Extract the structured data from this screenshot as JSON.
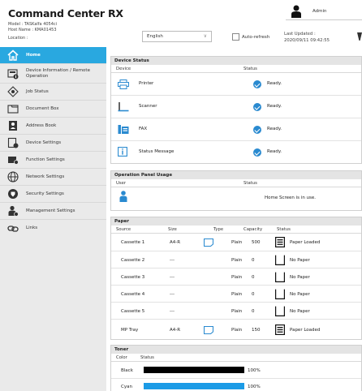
{
  "header": {
    "title": "Command Center RX",
    "model": "Model : TASKalfa 4054ci",
    "host_name": "Host Name : KMA01453",
    "location": "Location :",
    "language": "English",
    "auto_refresh": "Auto-refresh",
    "last_updated_label": "Last Updated :",
    "last_updated_value": "2020/09/11 09:42:55",
    "user": "Admin"
  },
  "sidebar": {
    "items": [
      {
        "label": "Home",
        "icon": "home-icon"
      },
      {
        "label": "Device Information / Remote Operation",
        "icon": "device-info-icon"
      },
      {
        "label": "Job Status",
        "icon": "job-status-icon"
      },
      {
        "label": "Document Box",
        "icon": "document-box-icon"
      },
      {
        "label": "Address Book",
        "icon": "address-book-icon"
      },
      {
        "label": "Device Settings",
        "icon": "device-settings-icon"
      },
      {
        "label": "Function Settings",
        "icon": "function-settings-icon"
      },
      {
        "label": "Network Settings",
        "icon": "network-globe-icon"
      },
      {
        "label": "Security Settings",
        "icon": "security-shield-icon"
      },
      {
        "label": "Management Settings",
        "icon": "management-user-icon"
      },
      {
        "label": "Links",
        "icon": "link-icon"
      }
    ]
  },
  "device_status": {
    "title": "Device Status",
    "col_device": "Device",
    "col_status": "Status",
    "rows": [
      {
        "device": "Printer",
        "status": "Ready.",
        "icon": "printer-icon"
      },
      {
        "device": "Scanner",
        "status": "Ready.",
        "icon": "scanner-icon"
      },
      {
        "device": "FAX",
        "status": "Ready.",
        "icon": "fax-icon"
      },
      {
        "device": "Status Message",
        "status": "Ready.",
        "icon": "info-icon"
      }
    ]
  },
  "panel_usage": {
    "title": "Operation Panel Usage",
    "col_user": "User",
    "col_status": "Status",
    "status": "Home Screen is in use.",
    "icon": "panel-user-icon"
  },
  "paper": {
    "title": "Paper",
    "columns": [
      "Source",
      "Size",
      "Type",
      "Capacity",
      "Status"
    ],
    "rows": [
      {
        "source": "Cassette 1",
        "size": "A4-R",
        "type": "Plain",
        "capacity": "500",
        "status": "Paper Loaded",
        "loaded": true
      },
      {
        "source": "Cassette 2",
        "size": "---",
        "type": "Plain",
        "capacity": "0",
        "status": "No Paper",
        "loaded": false
      },
      {
        "source": "Cassette 3",
        "size": "---",
        "type": "Plain",
        "capacity": "0",
        "status": "No Paper",
        "loaded": false
      },
      {
        "source": "Cassette 4",
        "size": "---",
        "type": "Plain",
        "capacity": "0",
        "status": "No Paper",
        "loaded": false
      },
      {
        "source": "Cassette 5",
        "size": "---",
        "type": "Plain",
        "capacity": "0",
        "status": "No Paper",
        "loaded": false
      },
      {
        "source": "MP Tray",
        "size": "A4-R",
        "type": "Plain",
        "capacity": "150",
        "status": "Paper Loaded",
        "loaded": true
      }
    ]
  },
  "toner": {
    "title": "Toner",
    "col_color": "Color",
    "col_status": "Status",
    "rows": [
      {
        "color": "Black",
        "level": "100%",
        "fill_percent": 100,
        "hex": "#000000"
      },
      {
        "color": "Cyan",
        "level": "100%",
        "fill_percent": 100,
        "hex": "#1c9be6"
      }
    ]
  },
  "colors": {
    "accent": "#29a8e0",
    "check": "#2a8ad0",
    "sidebar_bg": "#eaeaea"
  }
}
